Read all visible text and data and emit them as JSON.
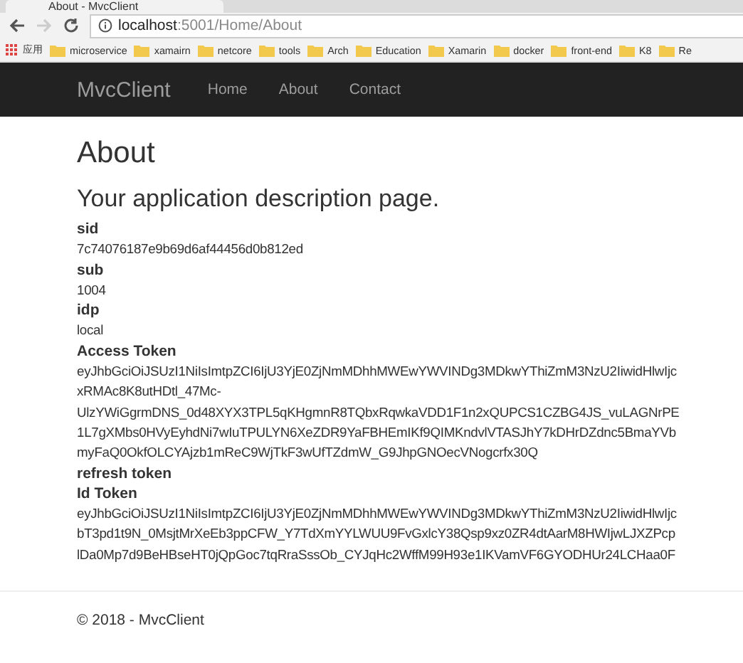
{
  "browser": {
    "tab_title": "About - MvcClient",
    "address": {
      "host": "localhost",
      "path": ":5001/Home/About"
    },
    "bookmarks": [
      {
        "label": "应用",
        "kind": "apps"
      },
      {
        "label": "microservice",
        "kind": "folder"
      },
      {
        "label": "xamairn",
        "kind": "folder"
      },
      {
        "label": "netcore",
        "kind": "folder"
      },
      {
        "label": "tools",
        "kind": "folder"
      },
      {
        "label": "Arch",
        "kind": "folder"
      },
      {
        "label": "Education",
        "kind": "folder"
      },
      {
        "label": "Xamarin",
        "kind": "folder"
      },
      {
        "label": "docker",
        "kind": "folder"
      },
      {
        "label": "front-end",
        "kind": "folder"
      },
      {
        "label": "K8",
        "kind": "folder"
      },
      {
        "label": "Re",
        "kind": "folder"
      }
    ]
  },
  "navbar": {
    "brand": "MvcClient",
    "links": [
      "Home",
      "About",
      "Contact"
    ]
  },
  "page": {
    "title": "About",
    "subtitle": "Your application description page.",
    "claims": [
      {
        "name": "sid",
        "value_lines": [
          "7c74076187e9b69d6af44456d0b812ed"
        ]
      },
      {
        "name": "sub",
        "value_lines": [
          "1004"
        ]
      },
      {
        "name": "idp",
        "value_lines": [
          "local"
        ]
      },
      {
        "name": "Access Token",
        "value_lines": [
          "eyJhbGciOiJSUzI1NiIsImtpZCI6IjU3YjE0ZjNmMDhhMWEwYWVINDg3MDkwYThiZmM3NzU2IiwidHlwIjc",
          "xRMAc8K8utHDtl_47Mc-",
          "UlzYWiGgrmDNS_0d48XYX3TPL5qKHgmnR8TQbxRqwkaVDD1F1n2xQUPCS1CZBG4JS_vuLAGNrPE",
          "1L7gXMbs0HVyEyhdNi7wIuTPULYN6XeZDR9YaFBHEmIKf9QIMKndvlVTASJhY7kDHrDZdnc5BmaYVb",
          "myFaQ0OkfOLCYAjzb1mReC9WjTkF3wUfTZdmW_G9JhpGNOecVNogcrfx30Q"
        ]
      },
      {
        "name": "refresh token"
      },
      {
        "name": "Id Token",
        "value_lines": [
          "eyJhbGciOiJSUzI1NiIsImtpZCI6IjU3YjE0ZjNmMDhhMWEwYWVINDg3MDkwYThiZmM3NzU2IiwidHlwIjc",
          "bT3pd1t9N_0MsjtMrXeEb3ppCFW_Y7TdXmYYLWUU9FvGxlcY38Qsp9xz0ZR4dtAarM8HWIjwLJXZPcp",
          "lDa0Mp7d9BeHBseHT0jQpGoc7tqRraSssOb_CYJqHc2WffM99H93e1IKVamVF6GYODHUr24LCHaa0F"
        ]
      }
    ]
  },
  "footer": {
    "text": "© 2018 - MvcClient"
  }
}
